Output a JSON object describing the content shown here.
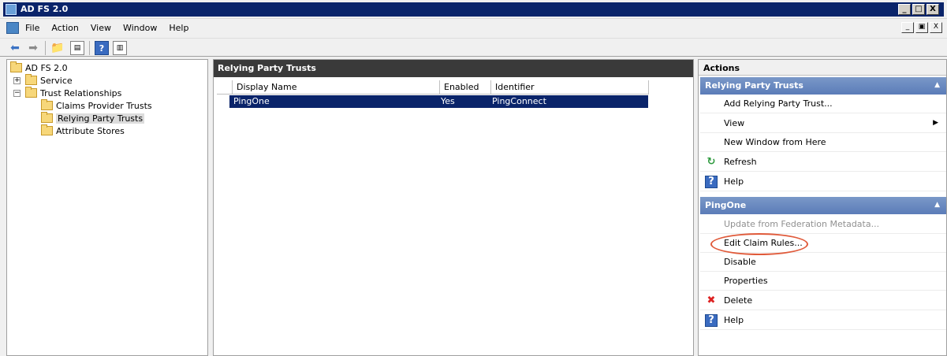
{
  "window": {
    "title": "AD FS 2.0",
    "controls": [
      "_",
      "□",
      "X"
    ],
    "mdi_controls": [
      "_",
      "▣",
      "X"
    ]
  },
  "menu": {
    "items": [
      "File",
      "Action",
      "View",
      "Window",
      "Help"
    ]
  },
  "toolbar": {
    "icons": [
      "back-arrow-icon",
      "forward-arrow-icon",
      "up-folder-icon",
      "show-hide-tree-icon",
      "help-icon",
      "show-hide-action-pane-icon"
    ]
  },
  "tree": {
    "root": "AD FS 2.0",
    "items": [
      {
        "label": "Service",
        "expander": "+"
      },
      {
        "label": "Trust Relationships",
        "expander": "−"
      },
      {
        "label": "Claims Provider Trusts"
      },
      {
        "label": "Relying Party Trusts"
      },
      {
        "label": "Attribute Stores"
      }
    ]
  },
  "center": {
    "header": "Relying Party Trusts",
    "columns": [
      "Display Name",
      "Enabled",
      "Identifier"
    ],
    "rows": [
      {
        "display_name": "PingOne",
        "enabled": "Yes",
        "identifier": "PingConnect"
      }
    ]
  },
  "actions": {
    "title": "Actions",
    "section1": {
      "header": "Relying Party Trusts",
      "items": [
        {
          "label": "Add Relying Party Trust..."
        },
        {
          "label": "View"
        },
        {
          "label": "New Window from Here"
        },
        {
          "label": "Refresh"
        },
        {
          "label": "Help"
        }
      ]
    },
    "section2": {
      "header": "PingOne",
      "items": [
        {
          "label": "Update from Federation Metadata..."
        },
        {
          "label": "Edit Claim Rules..."
        },
        {
          "label": "Disable"
        },
        {
          "label": "Properties"
        },
        {
          "label": "Delete"
        },
        {
          "label": "Help"
        }
      ]
    }
  },
  "colors": {
    "selection": "#0a246a",
    "section_header": "#5b7cb8",
    "highlight_ellipse": "#e05a3a"
  }
}
